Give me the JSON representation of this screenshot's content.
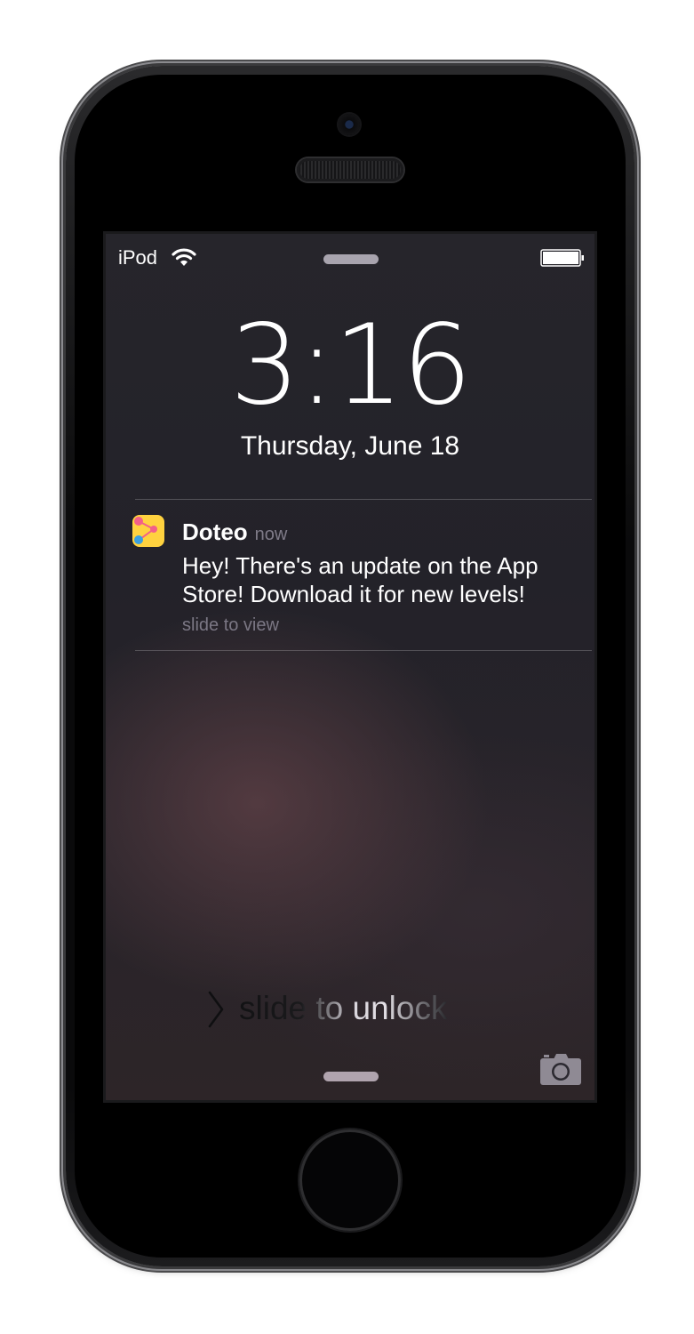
{
  "status_bar": {
    "carrier": "iPod",
    "wifi_icon": "wifi-icon",
    "battery_icon": "battery-full-icon"
  },
  "lock_screen": {
    "time": "3:16",
    "date": "Thursday, June 18"
  },
  "notification": {
    "app_name": "Doteo",
    "timestamp": "now",
    "message": "Hey! There's an update on the App Store! Download it for new levels!",
    "hint": "slide to view",
    "icon": "doteo-app-icon"
  },
  "unlock": {
    "label": "slide to unlock",
    "icon": "chevron-right-icon"
  },
  "camera": {
    "icon": "camera-icon"
  },
  "colors": {
    "screen_background": "#25242a",
    "text_primary": "#ffffff",
    "text_secondary": "#7f7b88",
    "app_icon_yellow": "#ffd23f",
    "app_icon_pink": "#f25f8a",
    "app_icon_blue": "#3aa0e0"
  }
}
